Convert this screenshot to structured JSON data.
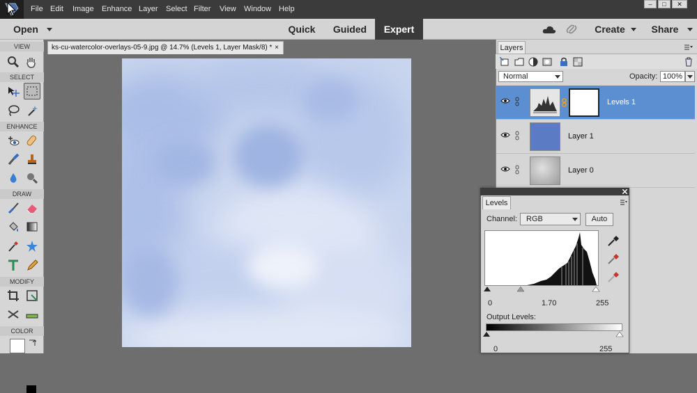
{
  "menu": {
    "items": [
      "File",
      "Edit",
      "Image",
      "Enhance",
      "Layer",
      "Select",
      "Filter",
      "View",
      "Window",
      "Help"
    ]
  },
  "modebar": {
    "open_label": "Open",
    "tabs": [
      "Quick",
      "Guided",
      "Expert"
    ],
    "active_tab": "Expert",
    "create_label": "Create",
    "share_label": "Share"
  },
  "toolbox": {
    "sections": [
      "VIEW",
      "SELECT",
      "ENHANCE",
      "DRAW",
      "MODIFY",
      "COLOR"
    ]
  },
  "document": {
    "tab_title": "ks-cu-watercolor-overlays-05-9.jpg @ 14.7% (Levels 1, Layer Mask/8) *",
    "close_glyph": "×"
  },
  "layers_panel": {
    "tab_label": "Layers",
    "blend_mode": "Normal",
    "opacity_label": "Opacity:",
    "opacity_value": "100%",
    "layers": [
      {
        "name": "Levels 1",
        "active": true
      },
      {
        "name": "Layer 1",
        "active": false
      },
      {
        "name": "Layer 0",
        "active": false
      }
    ]
  },
  "levels_panel": {
    "tab_label": "Levels",
    "channel_label": "Channel:",
    "channel_value": "RGB",
    "auto_label": "Auto",
    "input_black": "0",
    "input_gamma": "1.70",
    "input_white": "255",
    "output_label": "Output Levels:",
    "output_black": "0",
    "output_white": "255"
  },
  "colors": {
    "accent_selection": "#5b8fd2",
    "layer1_fill": "#5b7bc4",
    "canvas_tint": "#c7d3ec"
  }
}
